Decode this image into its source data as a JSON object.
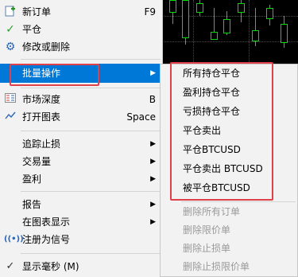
{
  "menu": {
    "items": [
      {
        "label": "新订单",
        "shortcut": "F9",
        "icon": "new-order-icon"
      },
      {
        "label": "平仓",
        "icon": "checkmark-icon"
      },
      {
        "label": "修改或删除",
        "icon": "gear-icon"
      },
      {
        "label": "批量操作",
        "icon": "",
        "submenu": true
      },
      {
        "label": "市场深度",
        "shortcut": "B",
        "icon": "market-depth-icon"
      },
      {
        "label": "打开图表",
        "shortcut": "Space",
        "icon": "chart-line-icon"
      },
      {
        "label": "追踪止损",
        "submenu": true
      },
      {
        "label": "交易量",
        "submenu": true
      },
      {
        "label": "盈利",
        "submenu": true
      },
      {
        "label": "报告",
        "submenu": true
      },
      {
        "label": "在图表显示",
        "submenu": true
      },
      {
        "label": "注册为信号",
        "icon": "signal-icon"
      },
      {
        "label": "显示毫秒 (M)",
        "icon": "checkmark-icon"
      }
    ]
  },
  "submenu": {
    "items": [
      {
        "label": "所有持仓平仓",
        "enabled": true
      },
      {
        "label": "盈利持仓平仓",
        "enabled": true
      },
      {
        "label": "亏损持仓平仓",
        "enabled": true
      },
      {
        "label": "平仓卖出",
        "enabled": true
      },
      {
        "label": "平仓BTCUSD",
        "enabled": true
      },
      {
        "label": "平仓卖出 BTCUSD",
        "enabled": true
      },
      {
        "label": "被平仓BTCUSD",
        "enabled": true
      },
      {
        "label": "删除所有订单",
        "enabled": false
      },
      {
        "label": "删除限价单",
        "enabled": false
      },
      {
        "label": "删除止损单",
        "enabled": false
      },
      {
        "label": "删除止损限价单",
        "enabled": false
      }
    ]
  },
  "colors": {
    "highlight": "#0078d7",
    "annotation": "#e0404a",
    "candle": "#00e000"
  }
}
